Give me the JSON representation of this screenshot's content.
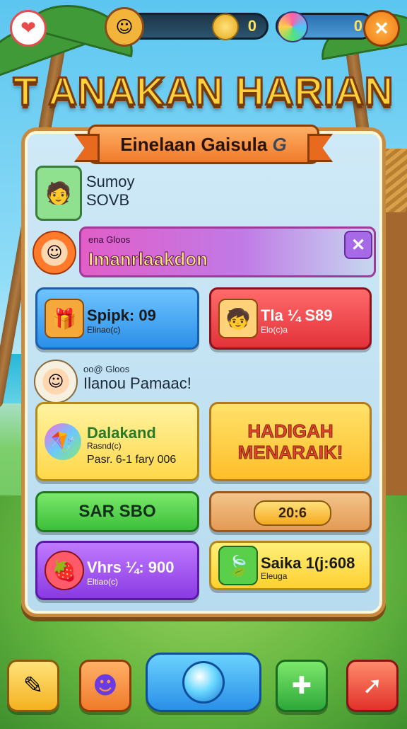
{
  "top_bar": {
    "coins": "0",
    "gems": "0",
    "close_label": "✕"
  },
  "title": "T ANAKAN HARIAN",
  "panel": {
    "ribbon_title": "Einelaan Gaisula",
    "ribbon_icon": "G",
    "profile": {
      "line1": "Sumoy",
      "line2": "SOVB"
    },
    "banner": {
      "small": "ena      Gloos",
      "big": "Imanrlaakdon"
    },
    "section2_label": {
      "small": "oo@       Gloos",
      "big": "Ilanou Pamaac!"
    },
    "cards": {
      "blue": {
        "l1": "Spipk: 09",
        "l2": "Elinao(c)"
      },
      "red": {
        "l1": "Tla ¼ S89",
        "l2": "Elo(c)a"
      },
      "yellow1": {
        "l1": "Dalakand",
        "l2": "Rasnd(c)",
        "l3": "Pasr. 6-1 fary 006"
      },
      "yellow2": "HADIGAH MENARAIK!",
      "green": "SAR SBO",
      "orange_pill": "20:6",
      "purple": {
        "l1": "Vhrs ¼: 900",
        "l2": "Eltiao(c)"
      },
      "yellow3": {
        "l1": "Saika 1(j:608",
        "l2": "Eleuga"
      }
    }
  },
  "colors": {
    "title": "#ffd23a",
    "panel_border": "#c98a3f"
  }
}
